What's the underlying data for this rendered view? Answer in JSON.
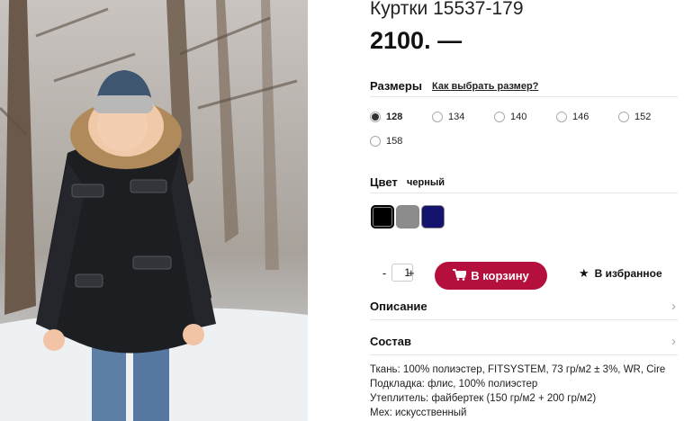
{
  "product": {
    "title": "Куртки 15537-179",
    "price": "2100. —"
  },
  "sizes": {
    "label": "Размеры",
    "guide_link": "Как выбрать размер?",
    "options": [
      "128",
      "134",
      "140",
      "146",
      "152",
      "158"
    ],
    "selected": "128"
  },
  "color": {
    "label": "Цвет",
    "value": "черный",
    "swatches": [
      {
        "name": "black",
        "hex": "#000000",
        "selected": true
      },
      {
        "name": "gray",
        "hex": "#8c8c8c",
        "selected": false
      },
      {
        "name": "navy",
        "hex": "#14146e",
        "selected": false
      }
    ]
  },
  "quantity": {
    "minus": "-",
    "value": "1",
    "plus": "+"
  },
  "cart_button": {
    "icon": "cart-icon",
    "label": "В корзину",
    "color": "#b5103d"
  },
  "favorite": {
    "icon": "star-icon",
    "label": "В избранное"
  },
  "accordion": {
    "description": "Описание",
    "composition": "Состав"
  },
  "composition_lines": [
    "Ткань: 100% полиэстер, FITSYSTEM, 73 гр/м2 ± 3%, WR, Cire",
    "Подкладка: флис, 100% полиэстер",
    "Утеплитель: файбертек (150 гр/м2 + 200 гр/м2)",
    "Мех: искусственный"
  ]
}
